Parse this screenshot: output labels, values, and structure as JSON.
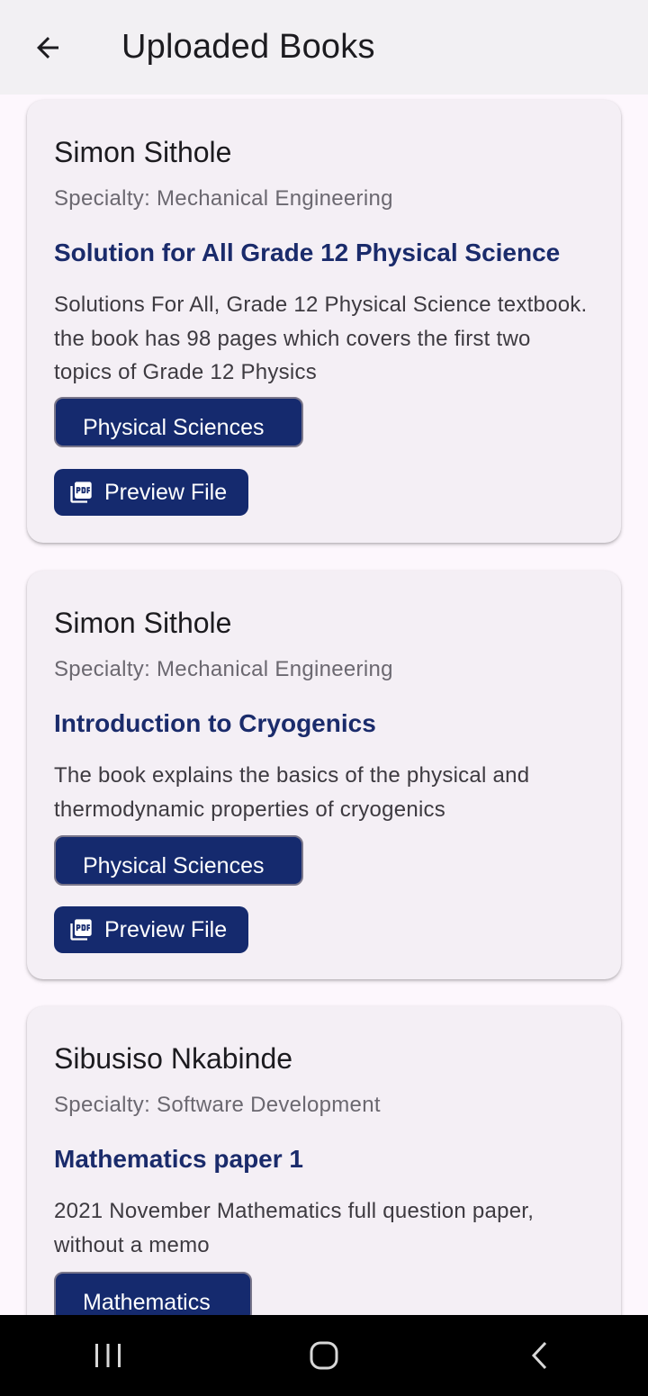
{
  "appbar": {
    "title": "Uploaded Books"
  },
  "books": [
    {
      "author": "Simon Sithole",
      "specialty": "Specialty: Mechanical Engineering",
      "title": "Solution for All Grade 12 Physical Science",
      "description": "Solutions For All, Grade 12 Physical Science textbook. the book has 98 pages which covers the first two topics of Grade 12 Physics",
      "subject": "Physical Sciences",
      "preview_label": "Preview File"
    },
    {
      "author": "Simon Sithole",
      "specialty": "Specialty: Mechanical Engineering",
      "title": "Introduction to Cryogenics",
      "description": "The book explains the basics of the physical and thermodynamic properties of cryogenics",
      "subject": "Physical Sciences",
      "preview_label": "Preview File"
    },
    {
      "author": "Sibusiso Nkabinde",
      "specialty": "Specialty: Software Development",
      "title": "Mathematics paper 1",
      "description": "2021 November Mathematics full question paper, without a memo",
      "subject": "Mathematics"
    }
  ],
  "colors": {
    "accent": "#152a6e",
    "title_text": "#1a2b6b",
    "card_bg": "#f4eff5",
    "appbar_bg": "#f2f0f3",
    "navbar_bg": "#000000"
  },
  "icons": {
    "back": "arrow-left-icon",
    "pdf": "pdf-file-icon",
    "nav_recents": "recents-icon",
    "nav_home": "home-icon",
    "nav_back": "nav-back-icon"
  }
}
